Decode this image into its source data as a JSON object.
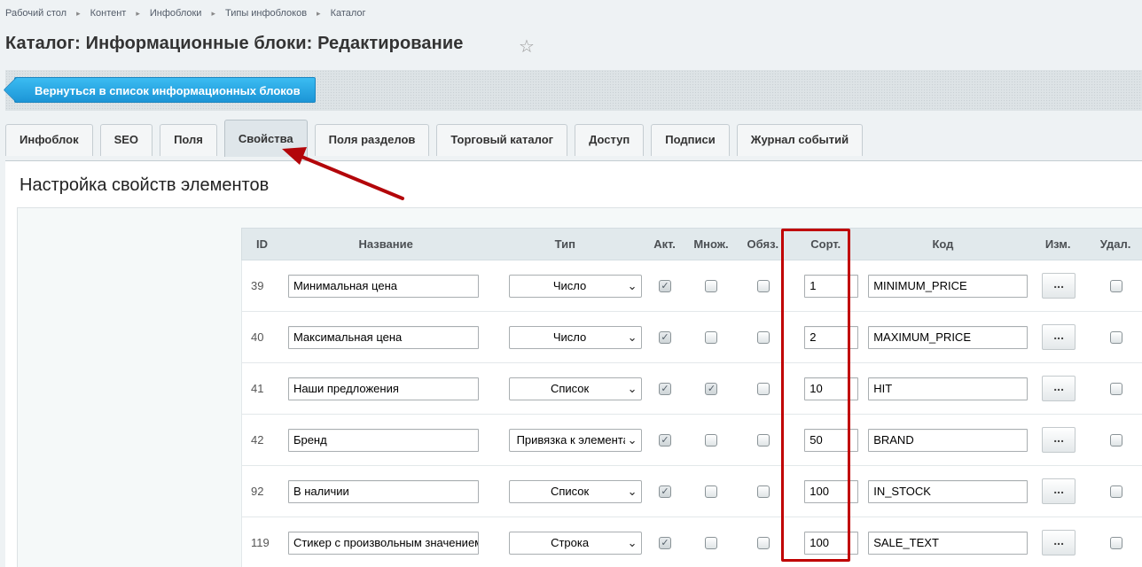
{
  "breadcrumb": [
    "Рабочий стол",
    "Контент",
    "Инфоблоки",
    "Типы инфоблоков",
    "Каталог"
  ],
  "page_title": "Каталог: Информационные блоки: Редактирование",
  "toolbar": {
    "back_label": "Вернуться в список информационных блоков"
  },
  "tabs": [
    {
      "label": "Инфоблок",
      "active": false
    },
    {
      "label": "SEO",
      "active": false
    },
    {
      "label": "Поля",
      "active": false
    },
    {
      "label": "Свойства",
      "active": true
    },
    {
      "label": "Поля разделов",
      "active": false
    },
    {
      "label": "Торговый каталог",
      "active": false
    },
    {
      "label": "Доступ",
      "active": false
    },
    {
      "label": "Подписи",
      "active": false
    },
    {
      "label": "Журнал событий",
      "active": false
    }
  ],
  "section_title": "Настройка свойств элементов",
  "table": {
    "headers": {
      "id": "ID",
      "name": "Название",
      "type": "Тип",
      "active": "Акт.",
      "multiple": "Множ.",
      "required": "Обяз.",
      "sort": "Сорт.",
      "code": "Код",
      "edit": "Изм.",
      "delete": "Удал."
    },
    "edit_button_label": "...",
    "rows": [
      {
        "id": "39",
        "name": "Минимальная цена",
        "type": "Число",
        "active": true,
        "multiple": false,
        "required": false,
        "sort": "1",
        "code": "MINIMUM_PRICE",
        "delete": false
      },
      {
        "id": "40",
        "name": "Максимальная цена",
        "type": "Число",
        "active": true,
        "multiple": false,
        "required": false,
        "sort": "2",
        "code": "MAXIMUM_PRICE",
        "delete": false
      },
      {
        "id": "41",
        "name": "Наши предложения",
        "type": "Список",
        "active": true,
        "multiple": true,
        "required": false,
        "sort": "10",
        "code": "HIT",
        "delete": false
      },
      {
        "id": "42",
        "name": "Бренд",
        "type": "Привязка к элементам",
        "active": true,
        "multiple": false,
        "required": false,
        "sort": "50",
        "code": "BRAND",
        "delete": false
      },
      {
        "id": "92",
        "name": "В наличии",
        "type": "Список",
        "active": true,
        "multiple": false,
        "required": false,
        "sort": "100",
        "code": "IN_STOCK",
        "delete": false
      },
      {
        "id": "119",
        "name": "Стикер с произвольным значением",
        "type": "Строка",
        "active": true,
        "multiple": false,
        "required": false,
        "sort": "100",
        "code": "SALE_TEXT",
        "delete": false
      }
    ]
  },
  "colors": {
    "highlight": "#c00000",
    "back_button": "#1c95d6"
  }
}
